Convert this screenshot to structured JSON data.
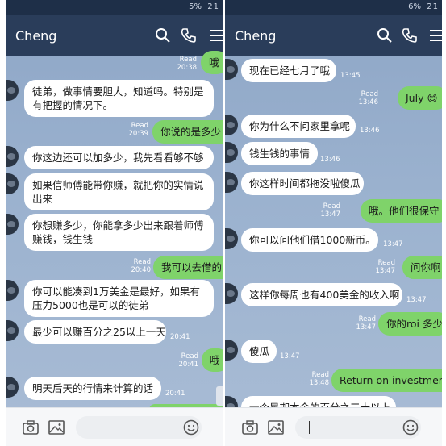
{
  "left": {
    "contact_name": "Cheng",
    "status": {
      "battery": "5%",
      "time": "21"
    },
    "messages": [
      {
        "dir": "out",
        "text": "哦",
        "read": "Read",
        "time": "20:38"
      },
      {
        "dir": "in",
        "line1": "徒弟，做事情要胆大，知道吗。特别是",
        "line2": "有把握的情况下。",
        "time": ""
      },
      {
        "dir": "out",
        "text": "你说的是多少",
        "read": "Read",
        "time": "20:39"
      },
      {
        "dir": "in",
        "text": "你这边还可以加多少，我先看看够不够",
        "time": ""
      },
      {
        "dir": "in",
        "line1": "如果信师傅能带你赚，就把你的实情说",
        "line2": "出来",
        "time": ""
      },
      {
        "dir": "in",
        "line1": "你想赚多少，你能拿多少出来跟着师傅",
        "line2": "赚钱，钱生钱",
        "time": ""
      },
      {
        "dir": "out",
        "text": "我可以去借的",
        "read": "Read",
        "time": "20:40"
      },
      {
        "dir": "in",
        "line1": "你可以能凑到1万美金是最好，如果有",
        "line2": "压力5000也是可以的徒弟",
        "time": ""
      },
      {
        "dir": "in",
        "text": "最少可以赚百分之25以上一天",
        "time": "20:41"
      },
      {
        "dir": "out",
        "text": "哦",
        "read": "Read",
        "time": "20:41"
      },
      {
        "dir": "in",
        "text": "明天后天的行情来计算的话",
        "time": "20:41"
      }
    ]
  },
  "right": {
    "contact_name": "Cheng",
    "status": {
      "battery": "6%",
      "time": "21"
    },
    "messages": [
      {
        "dir": "in",
        "text": "现在已经七月了哦",
        "time": "13:45"
      },
      {
        "dir": "out",
        "text": "July 😊",
        "read": "Read",
        "time": "13:46"
      },
      {
        "dir": "in",
        "text": "你为什么不问家里拿呢",
        "time": "13:46"
      },
      {
        "dir": "in",
        "text": "钱生钱的事情",
        "time": "13:46"
      },
      {
        "dir": "in",
        "text": "你这样时间都拖没啦傻瓜",
        "time": ""
      },
      {
        "dir": "out",
        "text": "哦。他们很保守",
        "read": "Read",
        "time": "13:47"
      },
      {
        "dir": "in",
        "text": "你可以问他们借1000新币。",
        "time": "13:47"
      },
      {
        "dir": "out",
        "text": "问你啊",
        "read": "Read",
        "time": "13:47"
      },
      {
        "dir": "in",
        "text": "这样你每周也有400美金的收入啊",
        "time": "13:47"
      },
      {
        "dir": "out",
        "text": "你的roi 多少",
        "read": "Read",
        "time": "13:47"
      },
      {
        "dir": "in",
        "text": "傻瓜",
        "time": "13:47"
      },
      {
        "dir": "out",
        "text": "Return on investment",
        "read": "Read",
        "time": "13:48"
      },
      {
        "dir": "in",
        "text": "一个星期本金的百分之三十以上",
        "time": ""
      }
    ]
  }
}
